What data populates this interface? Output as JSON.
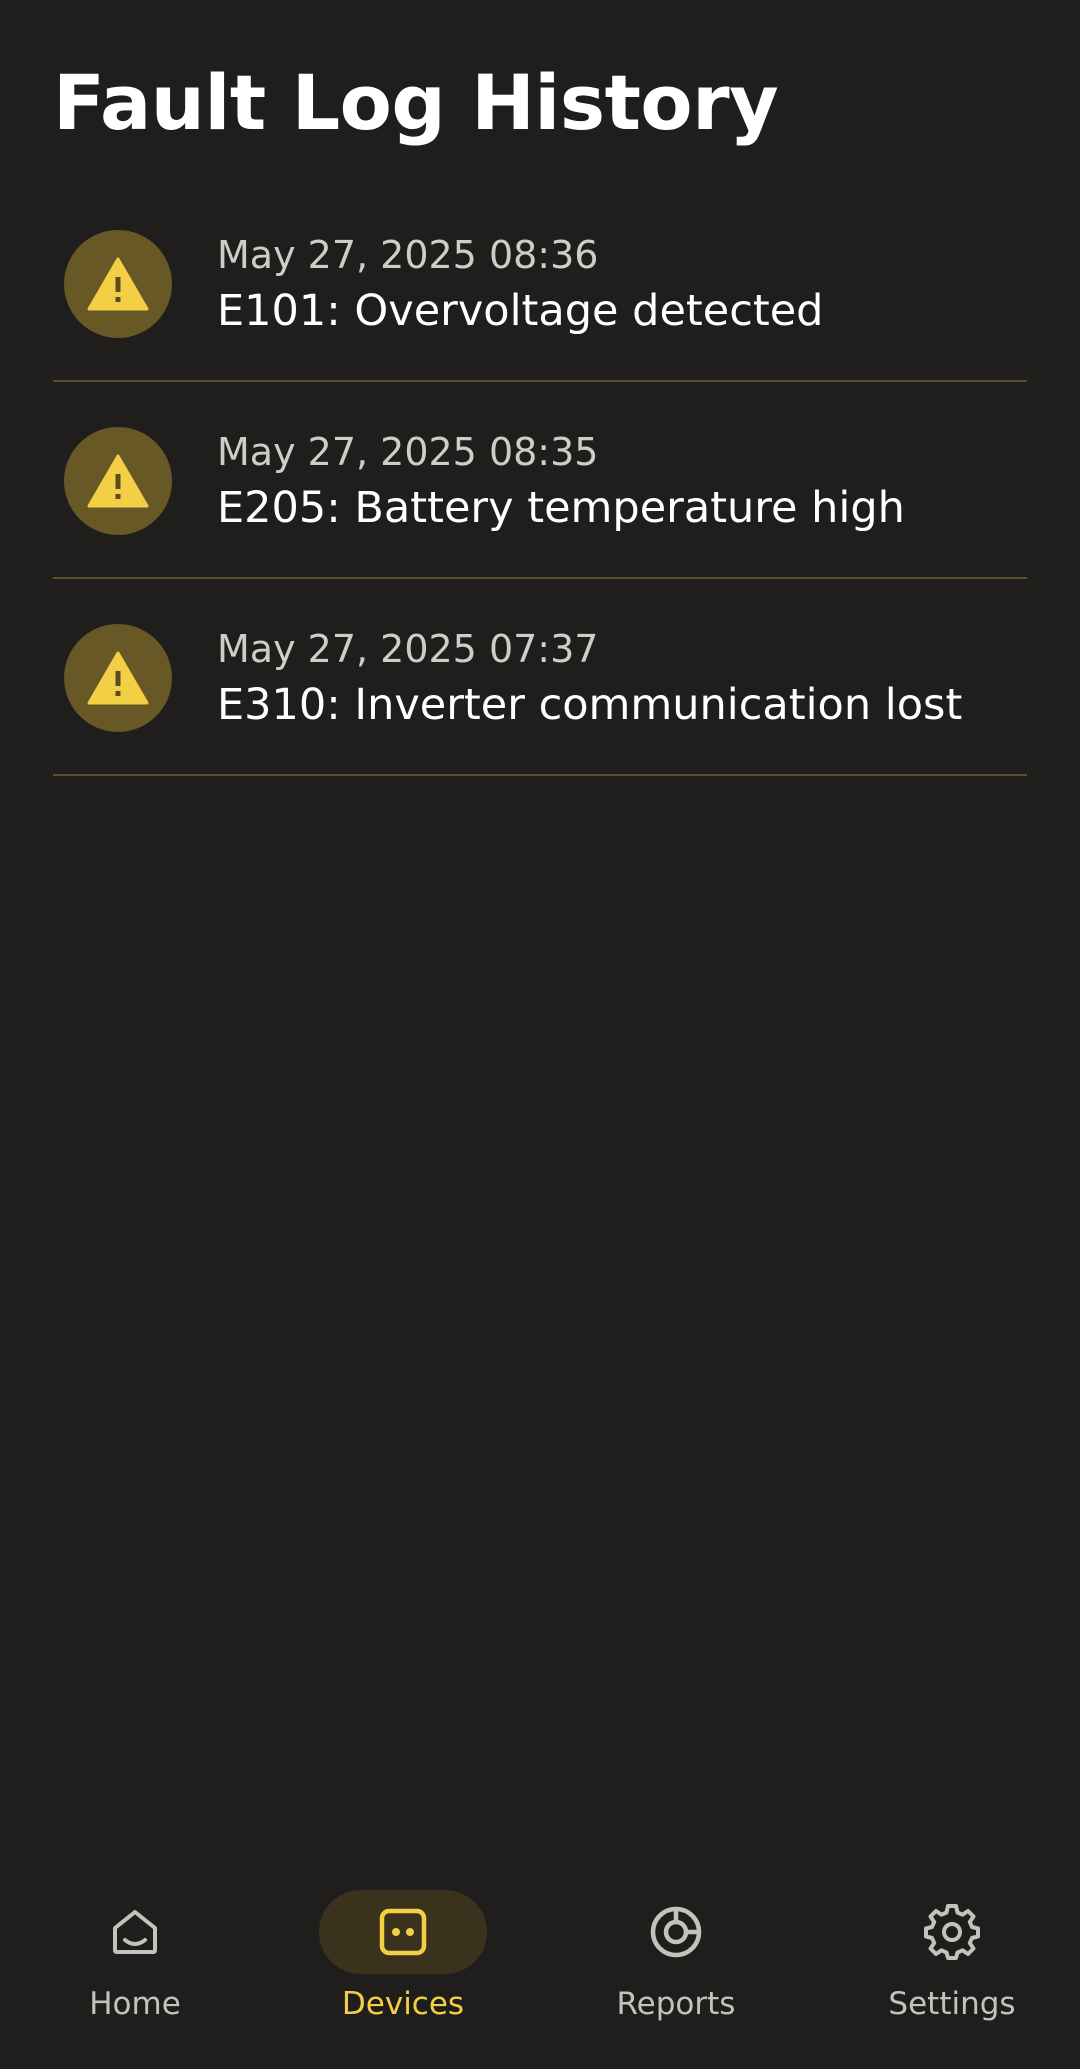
{
  "page": {
    "title": "Fault Log History"
  },
  "faults": [
    {
      "time": "May 27, 2025 08:36",
      "message": "E101: Overvoltage detected",
      "icon": "warning-icon"
    },
    {
      "time": "May 27, 2025 08:35",
      "message": "E205: Battery temperature high",
      "icon": "warning-icon"
    },
    {
      "time": "May 27, 2025 07:37",
      "message": "E310: Inverter communication lost",
      "icon": "warning-icon"
    }
  ],
  "nav": {
    "items": [
      {
        "label": "Home",
        "icon": "home-icon"
      },
      {
        "label": "Devices",
        "icon": "devices-icon",
        "active": true
      },
      {
        "label": "Reports",
        "icon": "reports-icon"
      },
      {
        "label": "Settings",
        "icon": "settings-icon"
      }
    ]
  },
  "colors": {
    "background": "#1f1e1d",
    "accent": "#f2cf45",
    "icon_circle": "#675826",
    "divider": "#5c5025",
    "active_pill": "#3a321d"
  }
}
